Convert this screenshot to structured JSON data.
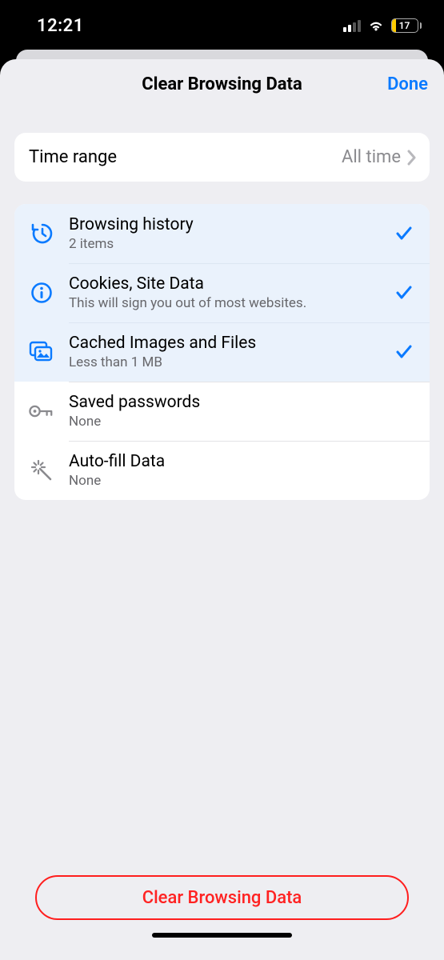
{
  "status": {
    "time": "12:21",
    "battery_pct": "17"
  },
  "sheet": {
    "title": "Clear Browsing Data",
    "done": "Done"
  },
  "time_range": {
    "label": "Time range",
    "value": "All time"
  },
  "options": [
    {
      "id": "history",
      "title": "Browsing history",
      "sub": "2 items",
      "selected": true
    },
    {
      "id": "cookies",
      "title": "Cookies, Site Data",
      "sub": "This will sign you out of most websites.",
      "selected": true
    },
    {
      "id": "cache",
      "title": "Cached Images and Files",
      "sub": "Less than 1 MB",
      "selected": true
    },
    {
      "id": "passwords",
      "title": "Saved passwords",
      "sub": "None",
      "selected": false
    },
    {
      "id": "autofill",
      "title": "Auto-fill Data",
      "sub": "None",
      "selected": false
    }
  ],
  "clear_button": "Clear Browsing Data",
  "colors": {
    "accent": "#0a7aff",
    "destructive": "#ff2222",
    "selected_bg": "#eaf2fc"
  }
}
